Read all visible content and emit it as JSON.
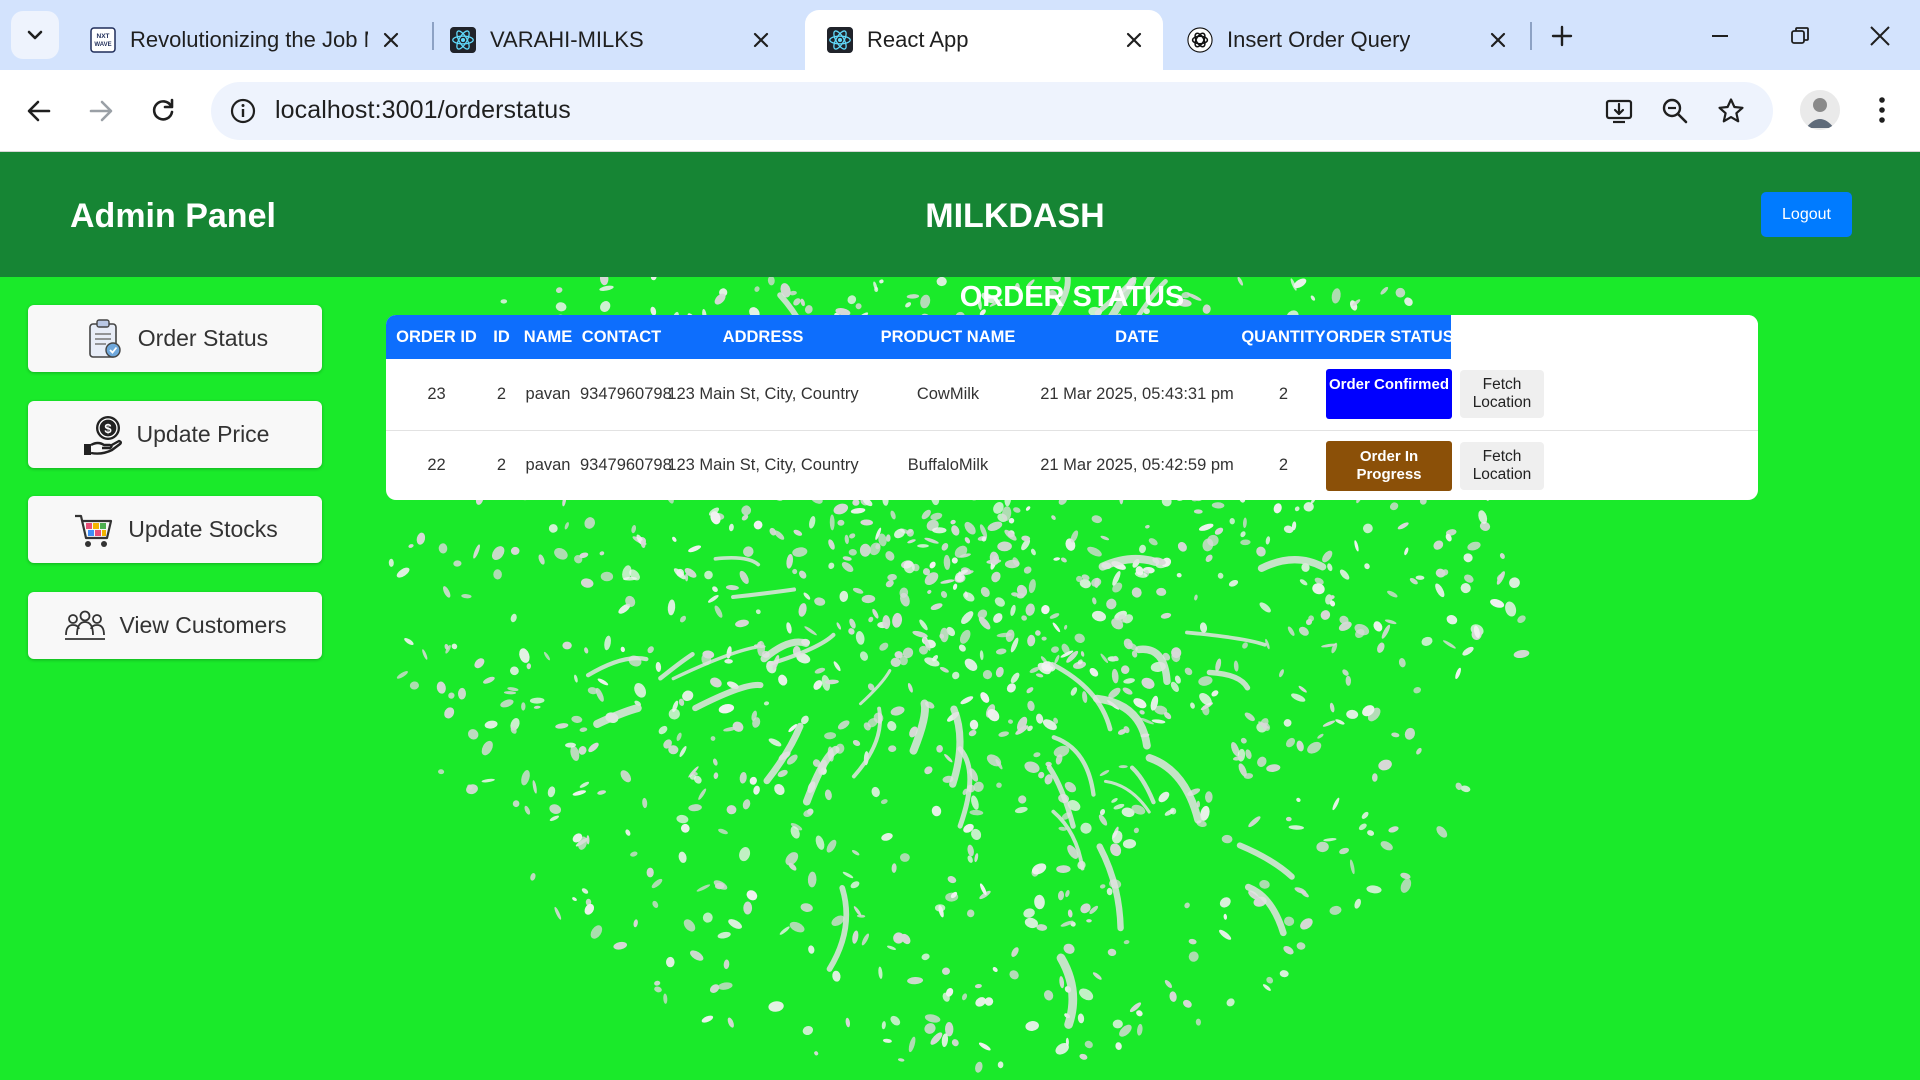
{
  "browser": {
    "tabs": [
      {
        "title": "Revolutionizing the Job M",
        "icon": "nxtwave-favicon",
        "active": false
      },
      {
        "title": "VARAHI-MILKS",
        "icon": "react-favicon",
        "active": false
      },
      {
        "title": "React App",
        "icon": "react-favicon",
        "active": true
      },
      {
        "title": "Insert Order Query",
        "icon": "openai-favicon",
        "active": false
      }
    ],
    "favicon_label": "NXT WAVE",
    "url": "localhost:3001/orderstatus"
  },
  "header": {
    "admin_title": "Admin Panel",
    "brand": "MILKDASH",
    "logout_label": "Logout",
    "bg_color": "#168534",
    "logout_color": "#007bff"
  },
  "sidebar": {
    "items": [
      {
        "label": "Order Status",
        "icon": "clipboard-icon"
      },
      {
        "label": "Update Price",
        "icon": "money-hand-icon"
      },
      {
        "label": "Update Stocks",
        "icon": "shopping-cart-icon"
      },
      {
        "label": "View Customers",
        "icon": "people-icon"
      }
    ]
  },
  "main": {
    "title": "ORDER STATUS",
    "columns": [
      "ORDER ID",
      "ID",
      "NAME",
      "CONTACT",
      "ADDRESS",
      "PRODUCT NAME",
      "DATE",
      "QUANTITY",
      "ORDER STATUS"
    ],
    "rows": [
      {
        "order_id": "23",
        "id": "2",
        "name": "pavan",
        "contact": "9347960798",
        "address": "123 Main St, City, Country",
        "product": "CowMilk",
        "date": "21 Mar 2025, 05:43:31 pm",
        "quantity": "2",
        "status": "Order Confirmed",
        "status_color": "#0000ff",
        "action": "Fetch Location"
      },
      {
        "order_id": "22",
        "id": "2",
        "name": "pavan",
        "contact": "9347960798",
        "address": "123 Main St, City, Country",
        "product": "BuffaloMilk",
        "date": "21 Mar 2025, 05:42:59 pm",
        "quantity": "2",
        "status": "Order In Progress",
        "status_color": "#8b5008",
        "action": "Fetch Location"
      }
    ]
  }
}
